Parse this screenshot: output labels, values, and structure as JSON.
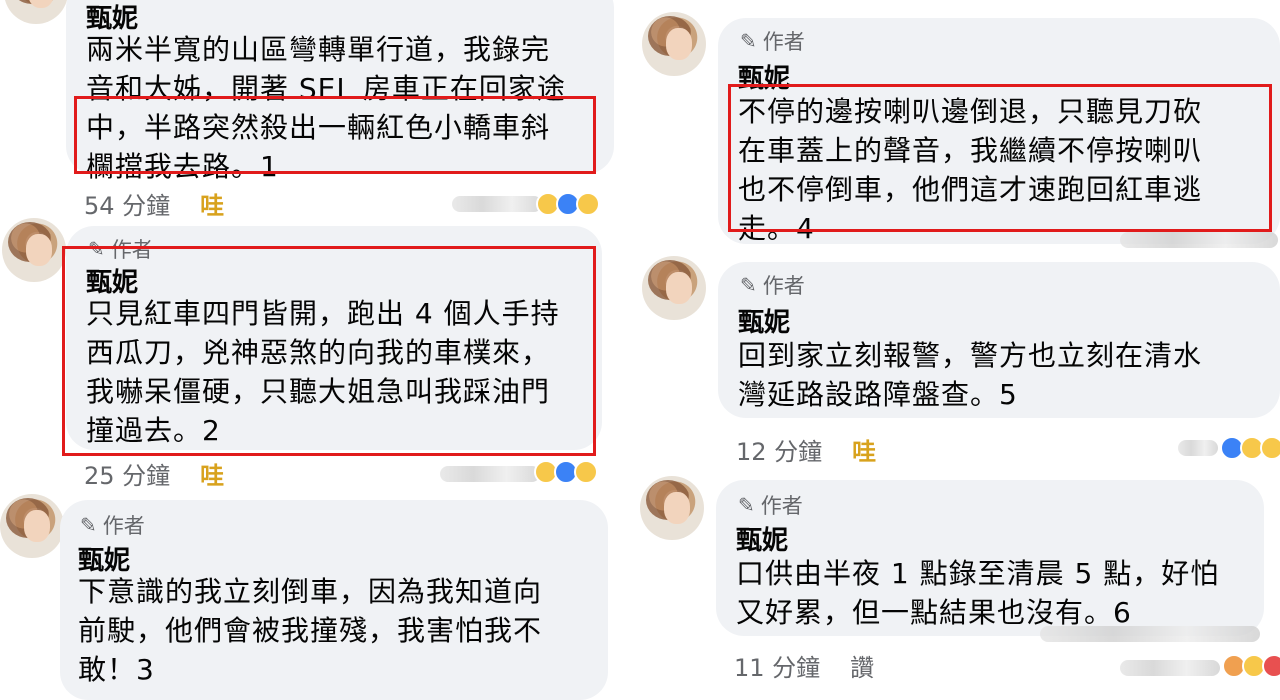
{
  "comments": [
    {
      "author_badge": "作者",
      "name": "甄妮",
      "lines": [
        "兩米半寬的山區彎轉單行道，我錄完",
        "音和大姊，開著 SEL 房車正在回家途",
        "中，半路突然殺出一輛紅色小轎車斜",
        "欄擋我去路。1"
      ],
      "time": "54 分鐘",
      "reaction": "哇"
    },
    {
      "author_badge": "作者",
      "name": "甄妮",
      "lines": [
        "只見紅車四門皆開，跑出 4 個人手持",
        "西瓜刀，兇神惡煞的向我的車樸來，",
        "我嚇呆僵硬，只聽大姐急叫我踩油門",
        "撞過去。2"
      ],
      "time": "25 分鐘",
      "reaction": "哇"
    },
    {
      "author_badge": "作者",
      "name": "甄妮",
      "lines": [
        "下意識的我立刻倒車，因為我知道向",
        "前駛，他們會被我撞殘，我害怕我不",
        "敢！3"
      ]
    },
    {
      "author_badge": "作者",
      "name": "甄妮",
      "lines": [
        "不停的邊按喇叭邊倒退，只聽見刀砍",
        "在車蓋上的聲音，我繼續不停按喇叭",
        "也不停倒車，他們這才速跑回紅車逃",
        "走。4"
      ]
    },
    {
      "author_badge": "作者",
      "name": "甄妮",
      "lines": [
        "回到家立刻報警，警方也立刻在清水",
        "灣延路設路障盤查。5"
      ],
      "time": "12 分鐘",
      "reaction": "哇"
    },
    {
      "author_badge": "作者",
      "name": "甄妮",
      "lines": [
        "口供由半夜 1 點錄至清晨 5 點，好怕",
        "又好累，但一點結果也沒有。6"
      ],
      "time": "11 分鐘",
      "reaction": "讚"
    }
  ],
  "colors": {
    "highlight_border": "#e11b1b",
    "bubble_bg": "#f0f2f5",
    "wa_reaction": "#d8a21d"
  },
  "icons": {
    "author_badge": "pencil-icon"
  }
}
